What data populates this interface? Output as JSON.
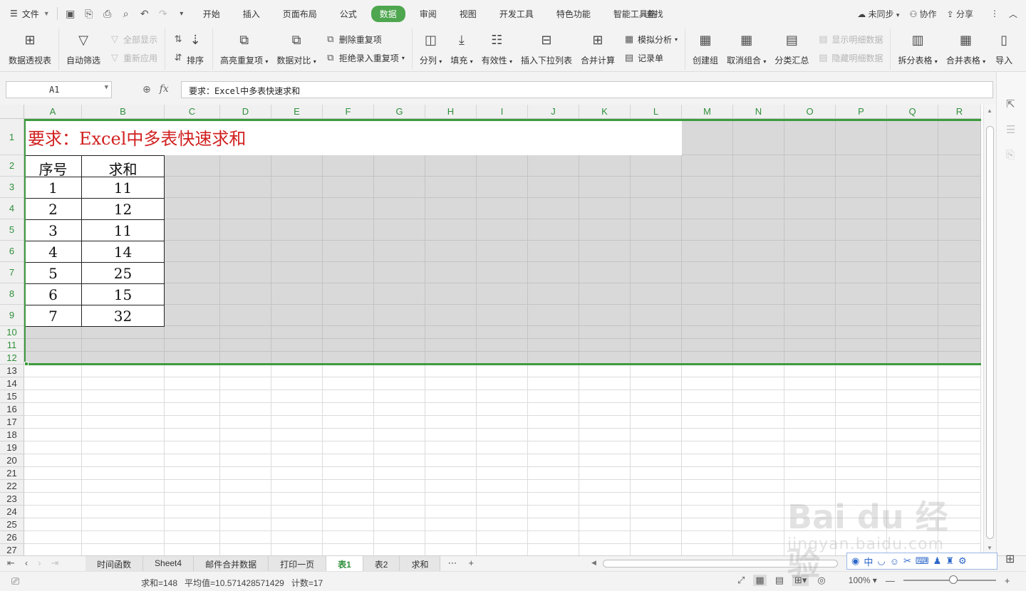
{
  "menubar": {
    "file_label": "文件",
    "tabs": [
      "开始",
      "插入",
      "页面布局",
      "公式",
      "数据",
      "审阅",
      "视图",
      "开发工具",
      "特色功能",
      "智能工具箱"
    ],
    "active_tab": "数据",
    "search_label": "查找",
    "sync_label": "未同步",
    "collab_label": "协作",
    "share_label": "分享"
  },
  "ribbon": {
    "pivot": "数据透视表",
    "autofilter": "自动筛选",
    "show_all": "全部显示",
    "reapply": "重新应用",
    "sort": "排序",
    "highlight_dup": "高亮重复项",
    "data_compare": "数据对比",
    "remove_dup": "删除重复项",
    "reject_dup": "拒绝录入重复项",
    "split_col": "分列",
    "fill": "填充",
    "validity": "有效性",
    "insert_dropdown": "插入下拉列表",
    "consolidate": "合并计算",
    "whatif": "模拟分析",
    "record_form": "记录单",
    "create_group": "创建组",
    "ungroup": "取消组合",
    "subtotal": "分类汇总",
    "show_detail": "显示明细数据",
    "hide_detail": "隐藏明细数据",
    "split_table": "拆分表格",
    "merge_table": "合并表格",
    "import": "导入"
  },
  "formula_bar": {
    "cell_ref": "A1",
    "fx": "fx",
    "content": "要求：Excel中多表快速求和"
  },
  "columns": [
    "A",
    "B",
    "C",
    "D",
    "E",
    "F",
    "G",
    "H",
    "I",
    "J",
    "K",
    "L",
    "M",
    "N",
    "O",
    "P",
    "Q",
    "R"
  ],
  "rows": [
    "1",
    "2",
    "3",
    "4",
    "5",
    "6",
    "7",
    "8",
    "9",
    "10",
    "11",
    "12",
    "13",
    "14",
    "15",
    "16",
    "17",
    "18",
    "19",
    "20",
    "21",
    "22",
    "23",
    "24",
    "25",
    "26",
    "27"
  ],
  "sheet": {
    "title": "要求：Excel中多表快速求和",
    "headers": [
      "序号",
      "求和"
    ],
    "table": [
      [
        "1",
        "11"
      ],
      [
        "2",
        "12"
      ],
      [
        "3",
        "11"
      ],
      [
        "4",
        "14"
      ],
      [
        "5",
        "25"
      ],
      [
        "6",
        "15"
      ],
      [
        "7",
        "32"
      ]
    ]
  },
  "sheet_tabs": [
    "时间函数",
    "Sheet4",
    "邮件合并数据",
    "打印一页",
    "表1",
    "表2",
    "求和"
  ],
  "active_sheet": "表1",
  "status": {
    "sum": "求和=148",
    "avg": "平均值=10.571428571429",
    "count": "计数=17",
    "zoom": "100%"
  },
  "watermark": {
    "main": "Bai du 经验",
    "sub": "jingyan.baidu.com"
  },
  "colors": {
    "accent": "#4ea64f",
    "title_red": "#d0201f",
    "selection": "#3d9b3e"
  }
}
